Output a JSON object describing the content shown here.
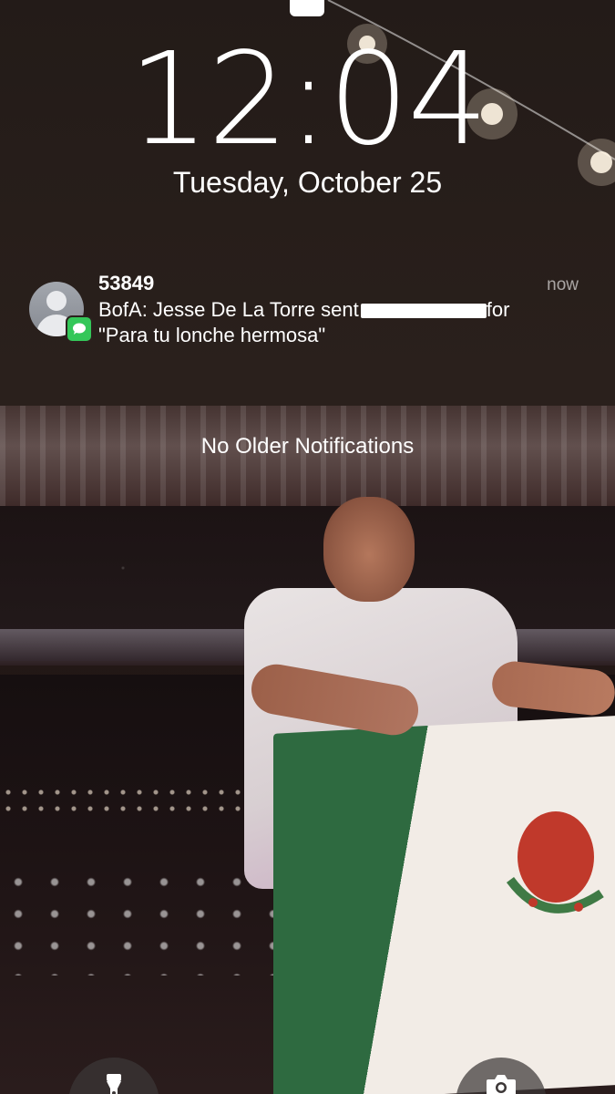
{
  "lockscreen": {
    "time": "12:04",
    "date": "Tuesday, October 25"
  },
  "notification": {
    "sender": "53849",
    "time": "now",
    "body_line1_start": "BofA: Jesse De La Torre sent",
    "body_line1_end": "for",
    "body_line2": "\"Para tu lonche hermosa\"",
    "app_icon": "messages-icon",
    "avatar_icon": "contact-avatar-icon"
  },
  "no_older_notifications": "No Older Notifications",
  "quick_actions": {
    "left_icon": "flashlight-icon",
    "right_icon": "camera-icon"
  },
  "colors": {
    "messages_badge": "#34c759",
    "text": "#ffffff"
  }
}
